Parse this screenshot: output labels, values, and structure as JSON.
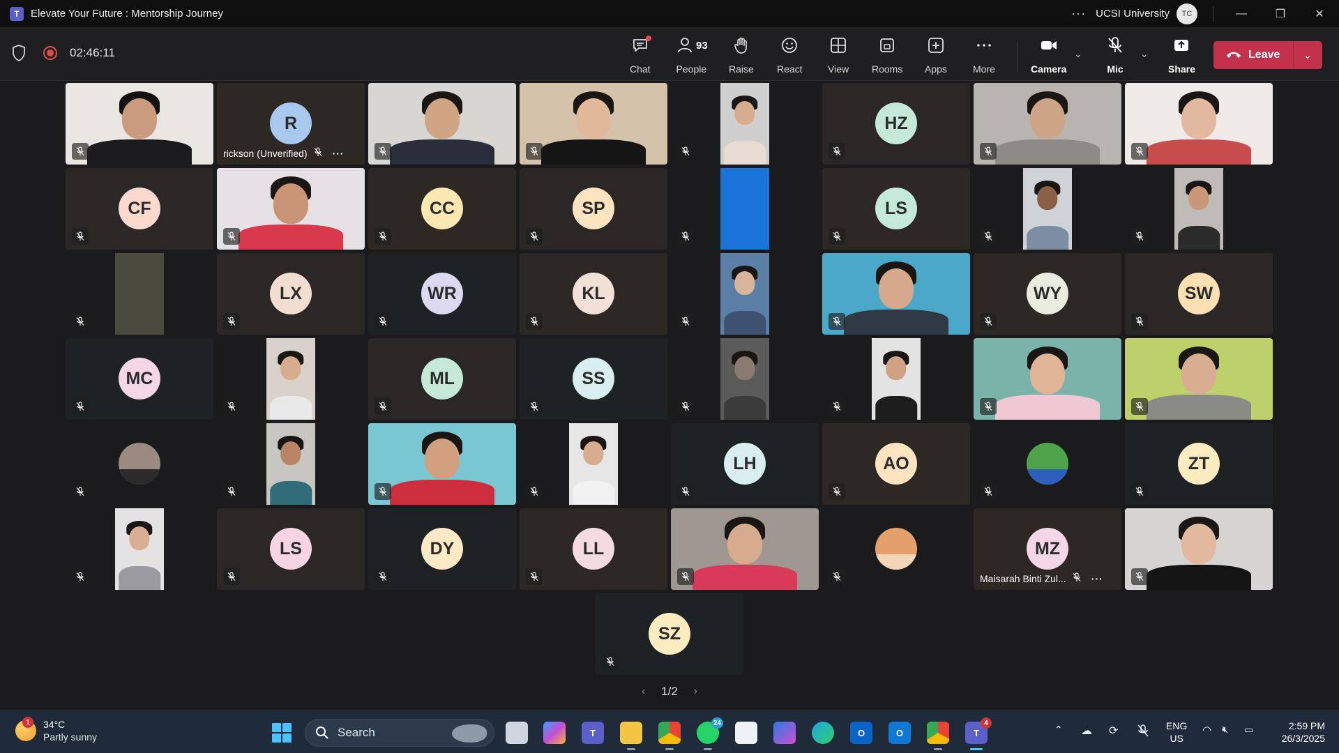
{
  "window": {
    "title": "Elevate Your Future : Mentorship Journey",
    "organization": "UCSI University",
    "user_initials": "TC",
    "more": "···",
    "minimize": "—",
    "maximize": "❐",
    "close": "✕"
  },
  "meeting": {
    "elapsed": "02:46:11",
    "toolbar": {
      "chat": "Chat",
      "people": "People",
      "people_count": "93",
      "raise": "Raise",
      "react": "React",
      "view": "View",
      "rooms": "Rooms",
      "apps": "Apps",
      "more": "More",
      "camera": "Camera",
      "mic": "Mic",
      "share": "Share",
      "leave": "Leave"
    },
    "pager": {
      "current": "1/2",
      "prev": "‹",
      "next": "›"
    }
  },
  "participants": [
    {
      "kind": "video",
      "vid": {
        "bg": "#e9e6e2",
        "skin": "#c99b7c",
        "shirt": "#1b1b1d",
        "w": 212,
        "cap": true
      }
    },
    {
      "kind": "avatar",
      "initials": "R",
      "avatar_color": "#a9c8ee",
      "name": "rickson (Unverified)",
      "more": "···"
    },
    {
      "kind": "video",
      "vid": {
        "bg": "#d8d6d3",
        "skin": "#d0a584",
        "shirt": "#2a2e3a",
        "w": 212
      }
    },
    {
      "kind": "video",
      "vid": {
        "bg": "#d4c2aa",
        "skin": "#e0b99a",
        "shirt": "#151515",
        "w": 212
      }
    },
    {
      "kind": "video",
      "vid": {
        "bg": "#cfcfcf",
        "skin": "#d7ad8e",
        "shirt": "#e8dcd5",
        "w": 70
      }
    },
    {
      "kind": "avatar",
      "initials": "HZ",
      "avatar_color": "#c4ead7"
    },
    {
      "kind": "video",
      "vid": {
        "bg": "#b8b5b0",
        "skin": "#cfa588",
        "shirt": "#8e8a85",
        "w": 212
      }
    },
    {
      "kind": "video",
      "vid": {
        "bg": "#efe9e7",
        "skin": "#e2b9a0",
        "shirt": "#c74d4d",
        "w": 212
      }
    },
    {
      "kind": "avatar",
      "initials": "CF",
      "avatar_color": "#fbd9cf"
    },
    {
      "kind": "video",
      "vid": {
        "bg": "#e6e1e4",
        "skin": "#c99476",
        "shirt": "#d93a4b",
        "w": 212
      }
    },
    {
      "kind": "avatar",
      "initials": "CC",
      "avatar_color": "#fbe7b2"
    },
    {
      "kind": "avatar",
      "initials": "SP",
      "avatar_color": "#fde3c0"
    },
    {
      "kind": "video",
      "vid": {
        "bg": "#1a73d9",
        "skin": "#1a73d9",
        "shirt": "#1a73d9",
        "w": 70,
        "plain": true
      }
    },
    {
      "kind": "avatar",
      "initials": "LS",
      "avatar_color": "#c4ead7"
    },
    {
      "kind": "video",
      "vid": {
        "bg": "#cfd2d6",
        "skin": "#8c6046",
        "shirt": "#7c8ea2",
        "w": 70
      }
    },
    {
      "kind": "video",
      "vid": {
        "bg": "#bfbcb8",
        "skin": "#c89878",
        "shirt": "#2b2b2b",
        "w": 70
      }
    },
    {
      "kind": "video",
      "vid": {
        "bg": "#4a4a3e",
        "skin": "#4a4a3e",
        "shirt": "#4a4a3e",
        "w": 70,
        "plain": true
      }
    },
    {
      "kind": "avatar",
      "initials": "LX",
      "avatar_color": "#f1ded1"
    },
    {
      "kind": "avatar",
      "initials": "WR",
      "avatar_color": "#dcd8ef"
    },
    {
      "kind": "avatar",
      "initials": "KL",
      "avatar_color": "#f3e0d6"
    },
    {
      "kind": "video",
      "vid": {
        "bg": "#5c7fa8",
        "skin": "#d8b49a",
        "shirt": "#3d5170",
        "w": 70
      }
    },
    {
      "kind": "video",
      "vid": {
        "bg": "#4aa9c9",
        "skin": "#d6a98a",
        "shirt": "#2f3a44",
        "w": 212
      }
    },
    {
      "kind": "avatar",
      "initials": "WY",
      "avatar_color": "#e9ecdf"
    },
    {
      "kind": "avatar",
      "initials": "SW",
      "avatar_color": "#fbe0b4"
    },
    {
      "kind": "avatar",
      "initials": "MC",
      "avatar_color": "#f4d6e6"
    },
    {
      "kind": "video",
      "vid": {
        "bg": "#d8d2cb",
        "skin": "#d7ad8e",
        "shirt": "#e9e9e9",
        "w": 70
      }
    },
    {
      "kind": "avatar",
      "initials": "ML",
      "avatar_color": "#c4ead7"
    },
    {
      "kind": "avatar",
      "initials": "SS",
      "avatar_color": "#d9eef0"
    },
    {
      "kind": "video",
      "vid": {
        "bg": "#5b5b5b",
        "skin": "#8a7a70",
        "shirt": "#3b3b3b",
        "w": 70
      }
    },
    {
      "kind": "video",
      "vid": {
        "bg": "#e3e3e3",
        "skin": "#d0a283",
        "shirt": "#1d1d1d",
        "w": 70
      }
    },
    {
      "kind": "video",
      "vid": {
        "bg": "#7ab3aa",
        "skin": "#e0b595",
        "shirt": "#f0c8d4",
        "w": 212
      }
    },
    {
      "kind": "video",
      "vid": {
        "bg": "#bed06a",
        "skin": "#d8ad90",
        "shirt": "#8a8a86",
        "w": 212
      }
    },
    {
      "kind": "video",
      "vid": {
        "bg": "#2c2a2a",
        "skin": "#9a8a80",
        "shirt": "#2c2a2a",
        "w": 60,
        "round": true
      }
    },
    {
      "kind": "video",
      "vid": {
        "bg": "#c8c6c0",
        "skin": "#b78566",
        "shirt": "#2f6d79",
        "w": 70
      }
    },
    {
      "kind": "video",
      "vid": {
        "bg": "#79c7d3",
        "skin": "#d0a081",
        "shirt": "#cc2e3e",
        "w": 212
      }
    },
    {
      "kind": "video",
      "vid": {
        "bg": "#e6e6e6",
        "skin": "#d7ad8e",
        "shirt": "#f2f2f2",
        "w": 70
      }
    },
    {
      "kind": "avatar",
      "initials": "LH",
      "avatar_color": "#d9eef0"
    },
    {
      "kind": "avatar",
      "initials": "AO",
      "avatar_color": "#fde3c0"
    },
    {
      "kind": "video",
      "vid": {
        "bg": "#2c2a2a",
        "skin": "#4fa34b",
        "shirt": "#2e5fbf",
        "w": 60,
        "round": true
      }
    },
    {
      "kind": "avatar",
      "initials": "ZT",
      "avatar_color": "#fdecc0"
    },
    {
      "kind": "video",
      "vid": {
        "bg": "#e4e2e3",
        "skin": "#d9ae92",
        "shirt": "#9a9aa0",
        "w": 70
      }
    },
    {
      "kind": "avatar",
      "initials": "LS",
      "avatar_color": "#f7d4e4"
    },
    {
      "kind": "avatar",
      "initials": "DY",
      "avatar_color": "#fde9c5"
    },
    {
      "kind": "avatar",
      "initials": "LL",
      "avatar_color": "#f4dbe0"
    },
    {
      "kind": "video",
      "vid": {
        "bg": "#9e9890",
        "skin": "#d6aa8c",
        "shirt": "#d93a5a",
        "w": 212
      }
    },
    {
      "kind": "video",
      "vid": {
        "bg": "#2c2a2a",
        "skin": "#e3a06a",
        "shirt": "#f3d6b8",
        "w": 60,
        "round": true
      }
    },
    {
      "kind": "avatar",
      "initials": "MZ",
      "avatar_color": "#f4d6e6",
      "name": "Maisarah Binti Zul...",
      "more": "···"
    },
    {
      "kind": "video",
      "vid": {
        "bg": "#d6d4d2",
        "skin": "#e2b99e",
        "shirt": "#141414",
        "w": 212
      }
    },
    {
      "kind": "avatar",
      "initials": "SZ",
      "avatar_color": "#fdecc0"
    }
  ],
  "taskbar": {
    "weather_temp": "34°C",
    "weather_desc": "Partly sunny",
    "weather_badge": "1",
    "search_label": "Search",
    "teams_badge": "4",
    "whatsapp_badge": "24",
    "lang_line1": "ENG",
    "lang_line2": "US",
    "time": "2:59 PM",
    "date": "26/3/2025",
    "colors": {
      "accent": "#4cc2ff",
      "leave": "#c4314b"
    }
  }
}
